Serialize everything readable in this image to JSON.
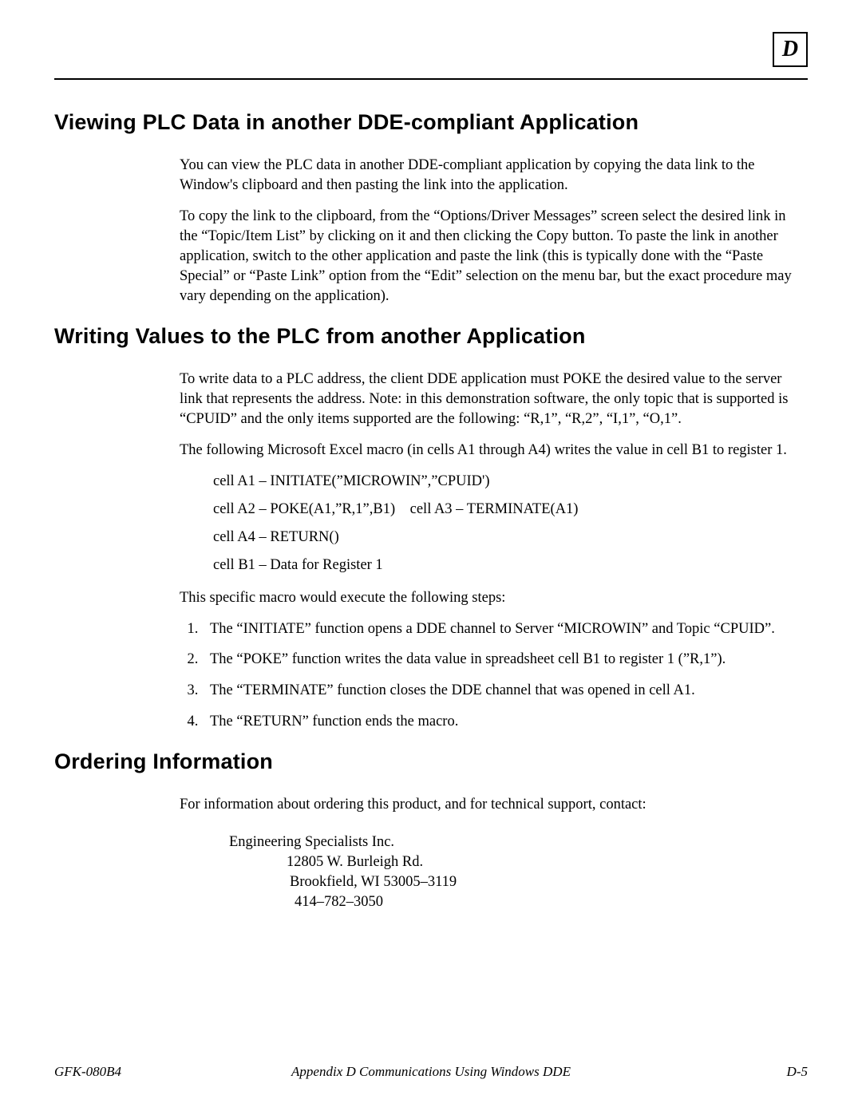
{
  "appendix_letter": "D",
  "heading1": "Viewing PLC Data in another DDE-compliant Application",
  "section1": {
    "p1": "You can view the PLC data in another DDE-compliant application by copying the data link to the Window's clipboard and then pasting the link into the application.",
    "p2": "To copy the link to the clipboard, from the “Options/Driver Messages” screen select the desired link in the “Topic/Item List” by clicking on it and then clicking the Copy button. To paste the link in another application, switch to the other application and paste the link (this is typically done with the “Paste Special” or “Paste Link” option from the “Edit” selection on the menu bar, but the exact procedure may vary depending on the application)."
  },
  "heading2": "Writing Values to the PLC from another Application",
  "section2": {
    "p1": "To write data to a PLC address, the client DDE application must POKE the desired value to the server link that represents the address. Note: in this demonstration software, the only topic that is supported is “CPUID” and  the only items supported are the following: “R,1”, “R,2”, “I,1”, “O,1”.",
    "p2": "The following Microsoft Excel macro (in cells A1 through A4) writes the value in cell B1 to register 1.",
    "macro": {
      "l1": "cell A1 – INITIATE(”MICROWIN”,”CPUID')",
      "l2": "cell A2 – POKE(A1,”R,1”,B1) cell A3 – TERMINATE(A1)",
      "l3": "cell A4 – RETURN()",
      "l4": "cell B1 – Data for Register 1"
    },
    "p3": "This specific macro would execute the following steps:",
    "steps": [
      "The “INITIATE” function opens a DDE channel to Server “MICROWIN” and  Topic “CPUID”.",
      "The “POKE” function writes the data value in spreadsheet cell B1 to register 1 (”R,1”).",
      "The “TERMINATE” function closes the DDE channel that was opened in  cell A1.",
      "The “RETURN” function ends the macro."
    ]
  },
  "heading3": "Ordering Information",
  "section3": {
    "p1": " For information about ordering this product, and for technical support, contact:",
    "address": {
      "name": "Engineering Specialists Inc.",
      "street": "12805 W. Burleigh Rd.",
      "city": "Brookfield, WI 53005–3119",
      "phone": "414–782–3050"
    }
  },
  "footer": {
    "left": "GFK-080B4",
    "center": "Appendix D Communications Using Windows DDE",
    "right": "D-5"
  }
}
